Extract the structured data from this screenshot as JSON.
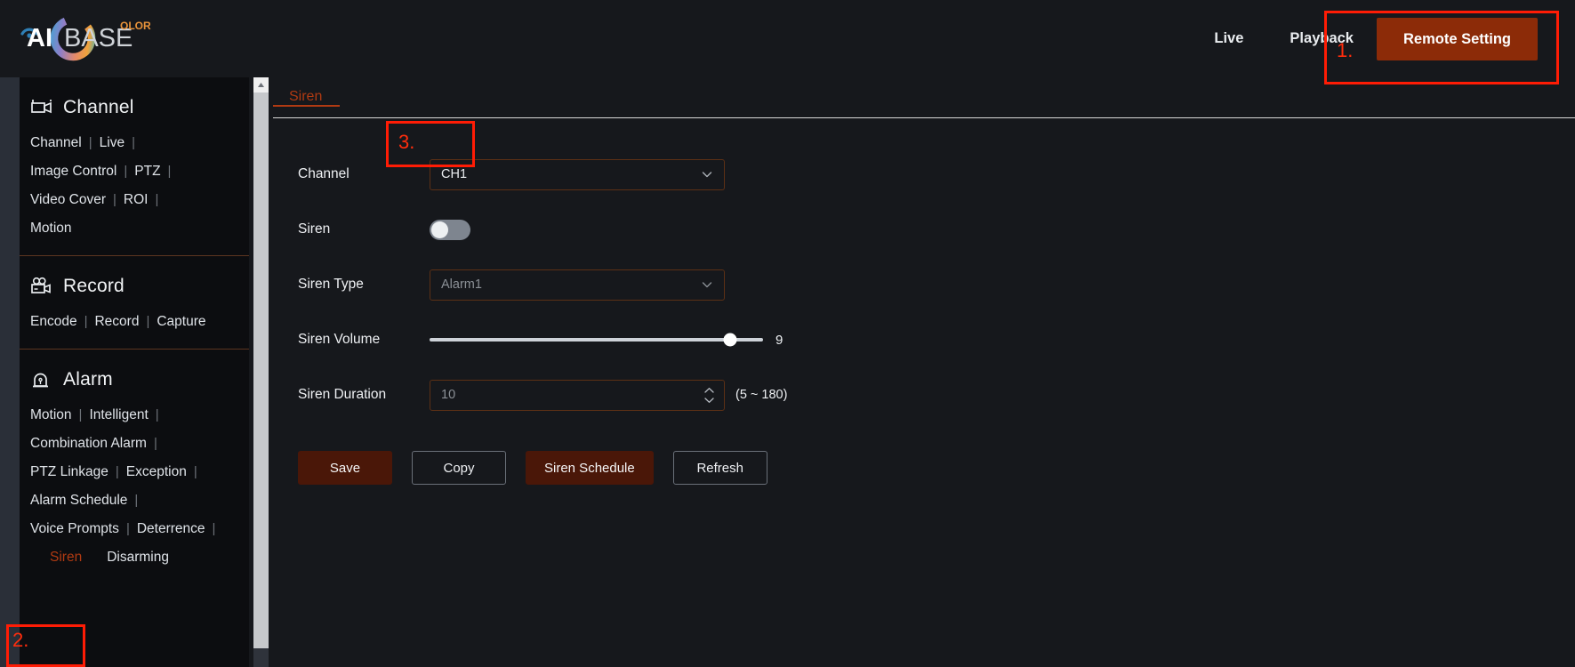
{
  "header": {
    "logo": {
      "primary_text": "AIBASE",
      "accent_text": "OLOR",
      "accent_color": "#e8933a"
    },
    "nav": [
      {
        "label": "Live",
        "active": false
      },
      {
        "label": "Playback",
        "active": false
      },
      {
        "label": "Remote Setting",
        "active": true
      }
    ],
    "active_nav_bg": "#8c2b08"
  },
  "annotations": [
    {
      "number": "1.",
      "target": "Remote Setting"
    },
    {
      "number": "2.",
      "target": "Siren"
    },
    {
      "number": "3.",
      "target": "CH1"
    }
  ],
  "sidebar": {
    "groups": [
      {
        "title": "Channel",
        "icon": "camera-icon",
        "rows": [
          [
            {
              "label": "Channel",
              "active": false
            },
            {
              "label": "Live",
              "active": false
            }
          ],
          [
            {
              "label": "Image Control",
              "active": false
            },
            {
              "label": "PTZ",
              "active": false
            }
          ],
          [
            {
              "label": "Video Cover",
              "active": false
            },
            {
              "label": "ROI",
              "active": false
            }
          ],
          [
            {
              "label": "Motion",
              "active": false
            }
          ]
        ]
      },
      {
        "title": "Record",
        "icon": "video-camera-icon",
        "rows": [
          [
            {
              "label": "Encode",
              "active": false
            },
            {
              "label": "Record",
              "active": false
            },
            {
              "label": "Capture",
              "active": false
            }
          ]
        ]
      },
      {
        "title": "Alarm",
        "icon": "siren-icon",
        "rows": [
          [
            {
              "label": "Motion",
              "active": false
            },
            {
              "label": "Intelligent",
              "active": false
            }
          ],
          [
            {
              "label": "Combination Alarm",
              "active": false
            }
          ],
          [
            {
              "label": "PTZ Linkage",
              "active": false
            },
            {
              "label": "Exception",
              "active": false
            }
          ],
          [
            {
              "label": "Alarm Schedule",
              "active": false
            }
          ],
          [
            {
              "label": "Voice Prompts",
              "active": false
            },
            {
              "label": "Deterrence",
              "active": false
            }
          ],
          [
            {
              "label": "Siren",
              "active": true
            },
            {
              "label": "Disarming",
              "active": false
            }
          ]
        ]
      }
    ],
    "separator_char": "|"
  },
  "main": {
    "tabs": [
      {
        "label": "Siren",
        "active": true
      }
    ],
    "form": {
      "channel": {
        "label": "Channel",
        "value": "CH1",
        "options": [
          "CH1"
        ]
      },
      "siren": {
        "label": "Siren",
        "enabled": false
      },
      "siren_type": {
        "label": "Siren Type",
        "value": "Alarm1",
        "options": [
          "Alarm1"
        ]
      },
      "siren_volume": {
        "label": "Siren Volume",
        "value": "9",
        "min": 0,
        "max": 10,
        "percent": 90
      },
      "siren_duration": {
        "label": "Siren Duration",
        "value": "10",
        "hint": "(5 ~ 180)"
      }
    },
    "buttons": [
      {
        "label": "Save",
        "style": "filled"
      },
      {
        "label": "Copy",
        "style": "outline"
      },
      {
        "label": "Siren Schedule",
        "style": "filled"
      },
      {
        "label": "Refresh",
        "style": "outline"
      }
    ]
  },
  "colors": {
    "accent": "#b03a12",
    "button_fill": "#4a1708",
    "annotation": "#ff1c05",
    "page_bg": "#16181c"
  }
}
